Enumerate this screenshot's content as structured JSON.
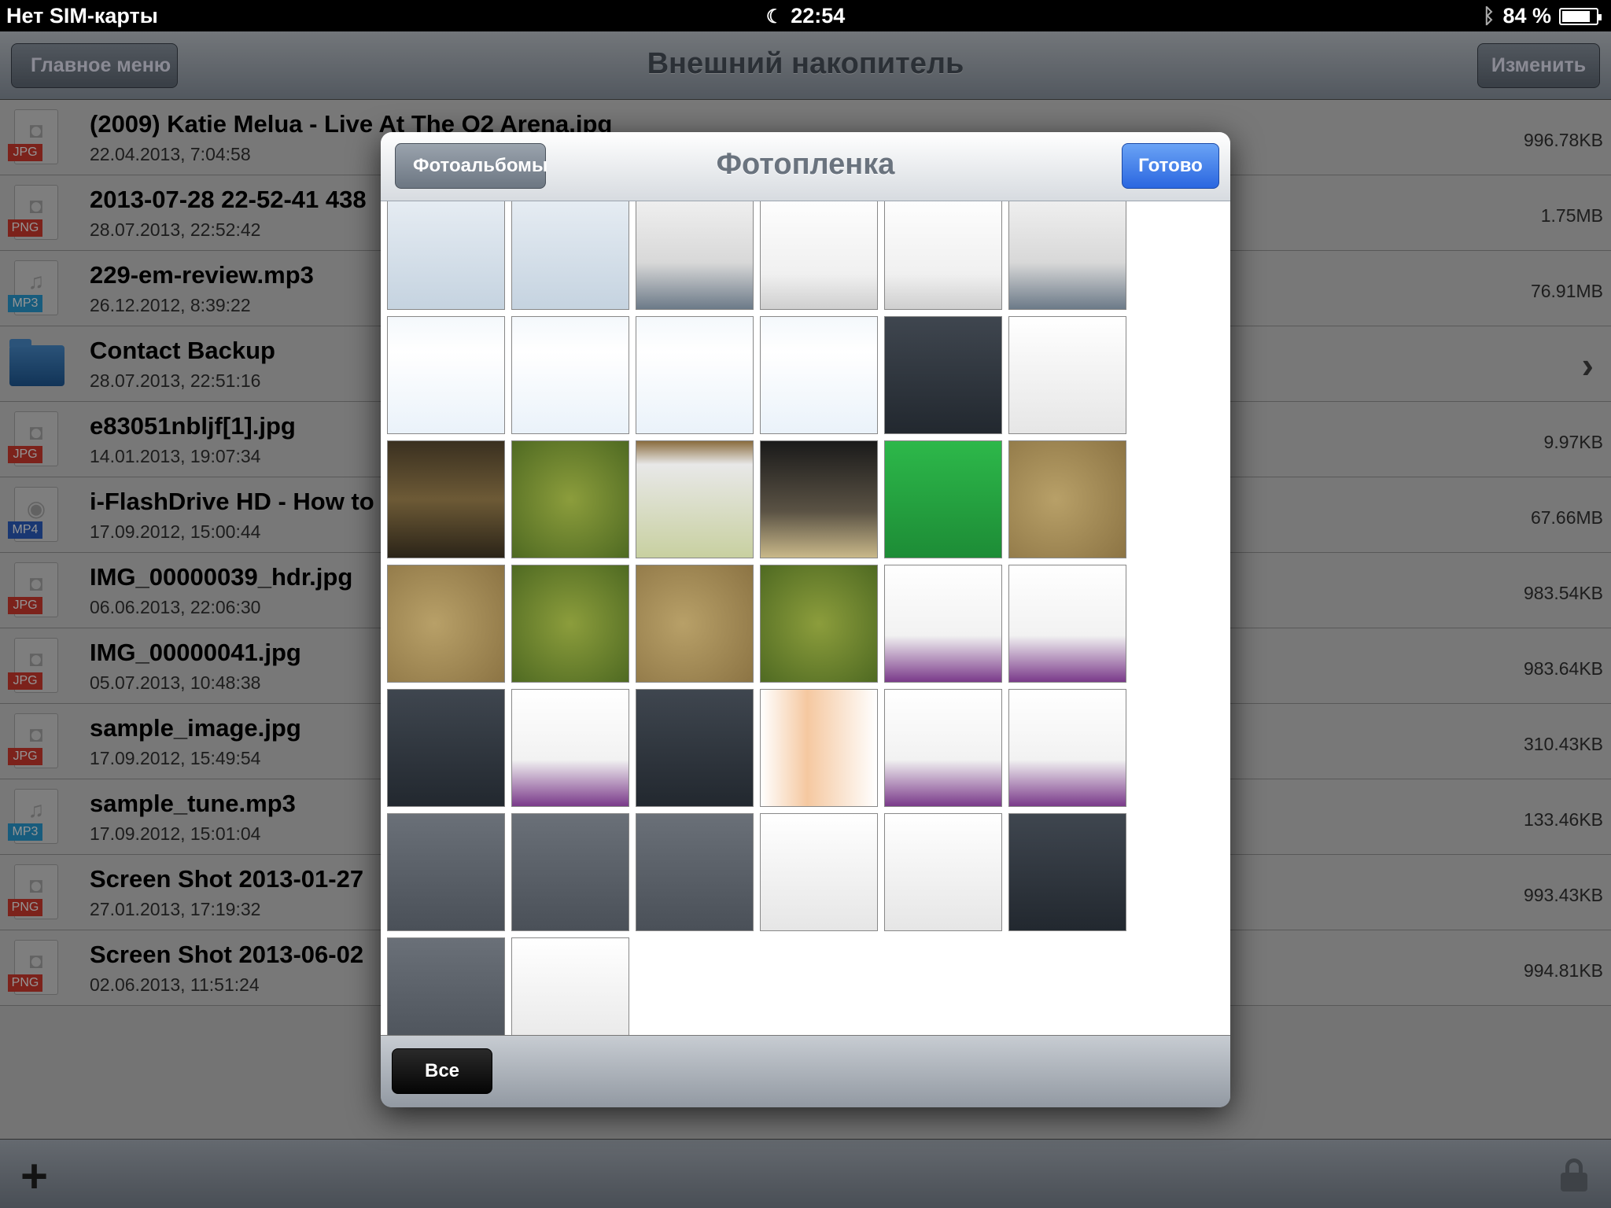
{
  "status": {
    "carrier": "Нет SIM-карты",
    "time": "22:54",
    "battery_text": "84 %",
    "battery_level": 0.84
  },
  "nav": {
    "back_label": "Главное меню",
    "title": "Внешний накопитель",
    "edit_label": "Изменить"
  },
  "files": [
    {
      "name": "(2009) Katie Melua  - Live At The O2 Arena.jpg",
      "date": "22.04.2013, 7:04:58",
      "size": "996.78KB",
      "ext": "JPG",
      "kind": "image",
      "color": "#d63b30"
    },
    {
      "name": "2013-07-28 22-52-41 438",
      "date": "28.07.2013, 22:52:42",
      "size": "1.75MB",
      "ext": "PNG",
      "kind": "image",
      "color": "#d63b30"
    },
    {
      "name": "229-em-review.mp3",
      "date": "26.12.2012, 8:39:22",
      "size": "76.91MB",
      "ext": "MP3",
      "kind": "audio",
      "color": "#2a9fd8"
    },
    {
      "name": "Contact Backup",
      "date": "28.07.2013, 22:51:16",
      "size": "",
      "ext": "",
      "kind": "folder",
      "color": "#2b6db5"
    },
    {
      "name": "e83051nbljf[1].jpg",
      "date": "14.01.2013, 19:07:34",
      "size": "9.97KB",
      "ext": "JPG",
      "kind": "image",
      "color": "#d63b30"
    },
    {
      "name": "i-FlashDrive HD - How to",
      "date": "17.09.2012, 15:00:44",
      "size": "67.66MB",
      "ext": "MP4",
      "kind": "video",
      "color": "#2b5fc5"
    },
    {
      "name": "IMG_00000039_hdr.jpg",
      "date": "06.06.2013, 22:06:30",
      "size": "983.54KB",
      "ext": "JPG",
      "kind": "image",
      "color": "#d63b30"
    },
    {
      "name": "IMG_00000041.jpg",
      "date": "05.07.2013, 10:48:38",
      "size": "983.64KB",
      "ext": "JPG",
      "kind": "image",
      "color": "#d63b30"
    },
    {
      "name": "sample_image.jpg",
      "date": "17.09.2012, 15:49:54",
      "size": "310.43KB",
      "ext": "JPG",
      "kind": "image",
      "color": "#d63b30"
    },
    {
      "name": "sample_tune.mp3",
      "date": "17.09.2012, 15:01:04",
      "size": "133.46KB",
      "ext": "MP3",
      "kind": "audio",
      "color": "#2a9fd8"
    },
    {
      "name": "Screen Shot 2013-01-27",
      "date": "27.01.2013, 17:19:32",
      "size": "993.43KB",
      "ext": "PNG",
      "kind": "image",
      "color": "#d63b30"
    },
    {
      "name": "Screen Shot 2013-06-02",
      "date": "02.06.2013, 11:51:24",
      "size": "994.81KB",
      "ext": "PNG",
      "kind": "image",
      "color": "#d63b30"
    }
  ],
  "popover": {
    "back_label": "Фотоальбомы",
    "title": "Фотопленка",
    "done_label": "Готово",
    "all_label": "Все"
  },
  "thumbnails": [
    {
      "theme": "light"
    },
    {
      "theme": "light"
    },
    {
      "theme": "weather"
    },
    {
      "theme": "form"
    },
    {
      "theme": "form"
    },
    {
      "theme": "weather"
    },
    {
      "theme": "graph"
    },
    {
      "theme": "graph"
    },
    {
      "theme": "graph"
    },
    {
      "theme": "graph"
    },
    {
      "theme": "dark"
    },
    {
      "theme": "doc"
    },
    {
      "theme": "forest"
    },
    {
      "theme": "game"
    },
    {
      "theme": "list"
    },
    {
      "theme": "photo"
    },
    {
      "theme": "green"
    },
    {
      "theme": "map"
    },
    {
      "theme": "map"
    },
    {
      "theme": "game"
    },
    {
      "theme": "map"
    },
    {
      "theme": "game"
    },
    {
      "theme": "web"
    },
    {
      "theme": "web"
    },
    {
      "theme": "dark"
    },
    {
      "theme": "web"
    },
    {
      "theme": "dark"
    },
    {
      "theme": "ad"
    },
    {
      "theme": "web"
    },
    {
      "theme": "web"
    },
    {
      "theme": "gray"
    },
    {
      "theme": "gray"
    },
    {
      "theme": "gray"
    },
    {
      "theme": "doc"
    },
    {
      "theme": "doc"
    },
    {
      "theme": "dark"
    },
    {
      "theme": "gray"
    },
    {
      "theme": "doc"
    }
  ]
}
